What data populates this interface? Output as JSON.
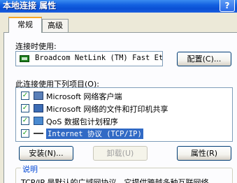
{
  "window": {
    "title": "本地连接 属性",
    "help_label": "?"
  },
  "tabs": [
    {
      "label": "常规",
      "active": true
    },
    {
      "label": "高级",
      "active": false
    }
  ],
  "general": {
    "connect_using_label": "连接时使用:",
    "adapter_name": "Broadcom NetLink (TM) Fast Eth",
    "configure_button": "配置(C)...",
    "items_label": "此连接使用下列项目(O):",
    "items": [
      {
        "label": "Microsoft 网络客户端",
        "checked": true,
        "icon": "network-client-icon"
      },
      {
        "label": "Microsoft 网络的文件和打印机共享",
        "checked": true,
        "icon": "file-share-icon"
      },
      {
        "label": "QoS 数据包计划程序",
        "checked": true,
        "icon": "qos-icon"
      },
      {
        "label": "Internet 协议 (TCP/IP)",
        "checked": true,
        "icon": "protocol-icon",
        "selected": true
      }
    ],
    "install_button": "安装(N)...",
    "uninstall_button": "卸载(U)",
    "properties_button": "属性(R)",
    "description_title": "说明",
    "description_text": "TCP/IP 是默认的广域网协议。它提供跨越多种互联网络"
  },
  "colors": {
    "title_bar": "#0a4fd4",
    "selection": "#316ac5",
    "dialog_bg": "#ece9d8"
  }
}
